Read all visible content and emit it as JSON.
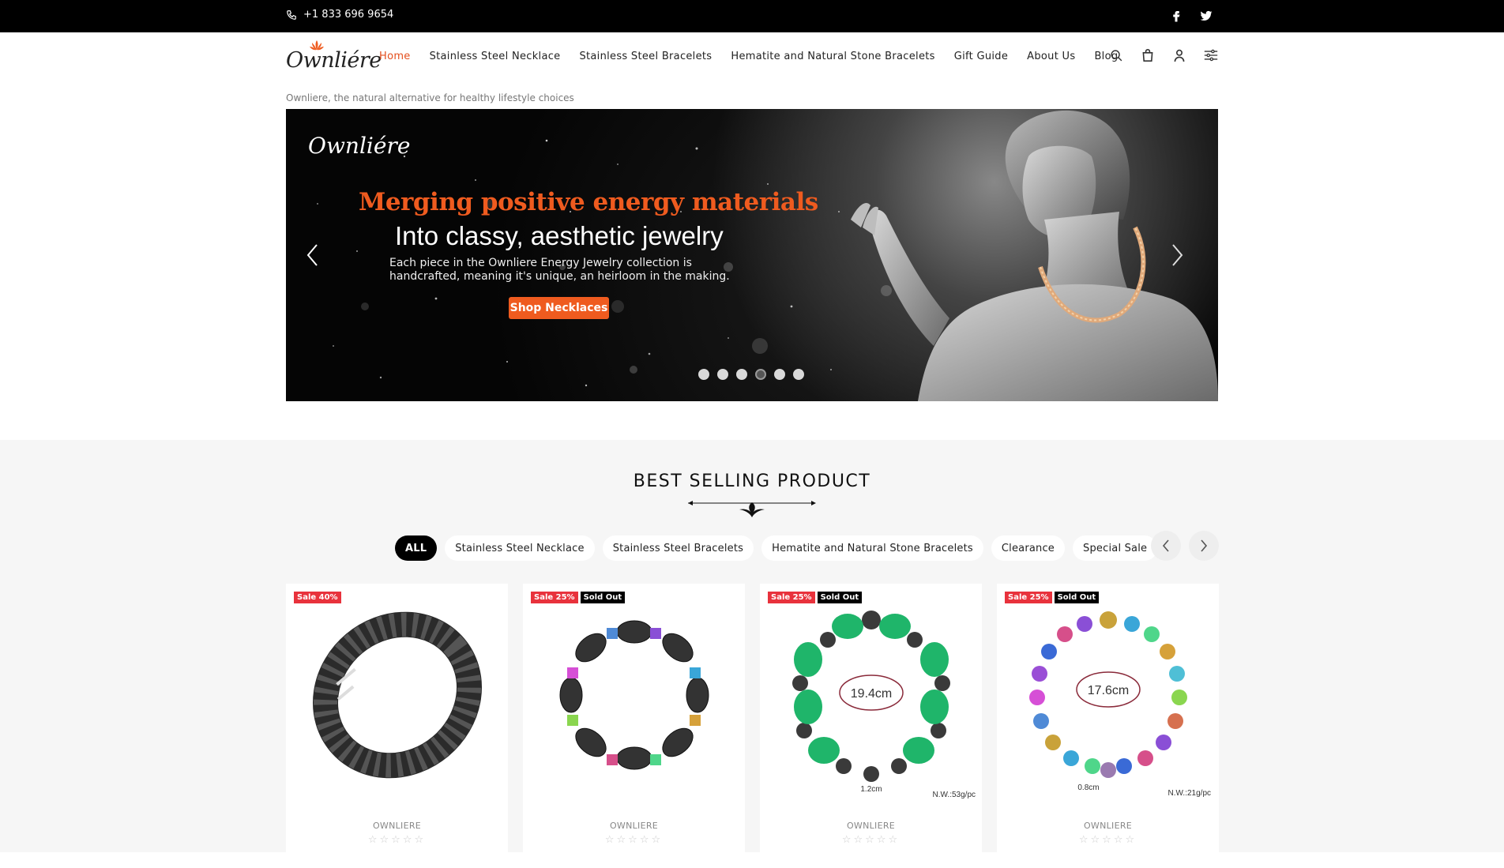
{
  "topbar": {
    "phone": "+1 833 696 9654",
    "socials": [
      "facebook-icon",
      "twitter-icon"
    ]
  },
  "header": {
    "logo_text": "Ownliére",
    "nav": [
      {
        "label": "Home",
        "active": true
      },
      {
        "label": "Stainless Steel Necklace"
      },
      {
        "label": "Stainless Steel Bracelets"
      },
      {
        "label": "Hematite and Natural Stone Bracelets"
      },
      {
        "label": "Gift Guide"
      },
      {
        "label": "About Us"
      },
      {
        "label": "Blog"
      }
    ],
    "icons": [
      "search-icon",
      "cart-icon",
      "account-icon",
      "settings-icon"
    ],
    "accent_color": "#e44e1c"
  },
  "tagline": "Ownliere, the natural alternative for healthy lifestyle choices",
  "hero": {
    "logo_text": "Ownliére",
    "headline": "Merging positive energy materials",
    "subline": "Into classy, aesthetic jewelry",
    "description": "Each piece in the Ownliere Energy Jewelry collection is handcrafted, meaning it's unique, an heirloom in the making.",
    "cta_label": "Shop Necklaces",
    "cta_color": "#ef5b1f",
    "slide_count": 6,
    "active_slide": 4
  },
  "best_selling": {
    "title": "BEST SELLING PRODUCT",
    "filters": [
      {
        "label": "ALL",
        "active": true
      },
      {
        "label": "Stainless Steel Necklace"
      },
      {
        "label": "Stainless Steel Bracelets"
      },
      {
        "label": "Hematite and Natural Stone Bracelets"
      },
      {
        "label": "Clearance"
      },
      {
        "label": "Special Sale"
      }
    ],
    "products": [
      {
        "brand": "OWNLIERE",
        "sale": "Sale 40%",
        "sold_out": null,
        "image": "black-magnetic-link-bracelet",
        "size_label": null,
        "weight": null,
        "bead_size": null,
        "rating": "☆☆☆☆☆"
      },
      {
        "brand": "OWNLIERE",
        "sale": "Sale 25%",
        "sold_out": "Sold Out",
        "image": "hematite-rainbow-bead-bracelet",
        "size_label": null,
        "weight": null,
        "bead_size": null,
        "rating": "☆☆☆☆☆"
      },
      {
        "brand": "OWNLIERE",
        "sale": "Sale 25%",
        "sold_out": "Sold Out",
        "image": "green-stone-hematite-bracelet",
        "size_label": "19.4cm",
        "weight": "N.W.:53g/pc",
        "bead_size": "1.2cm",
        "rating": "☆☆☆☆☆"
      },
      {
        "brand": "OWNLIERE",
        "sale": "Sale 25%",
        "sold_out": "Sold Out",
        "image": "rainbow-crystal-bracelet",
        "size_label": "17.6cm",
        "weight": "N.W.:21g/pc",
        "bead_size": "0.8cm",
        "rating": "☆☆☆☆☆"
      }
    ]
  }
}
